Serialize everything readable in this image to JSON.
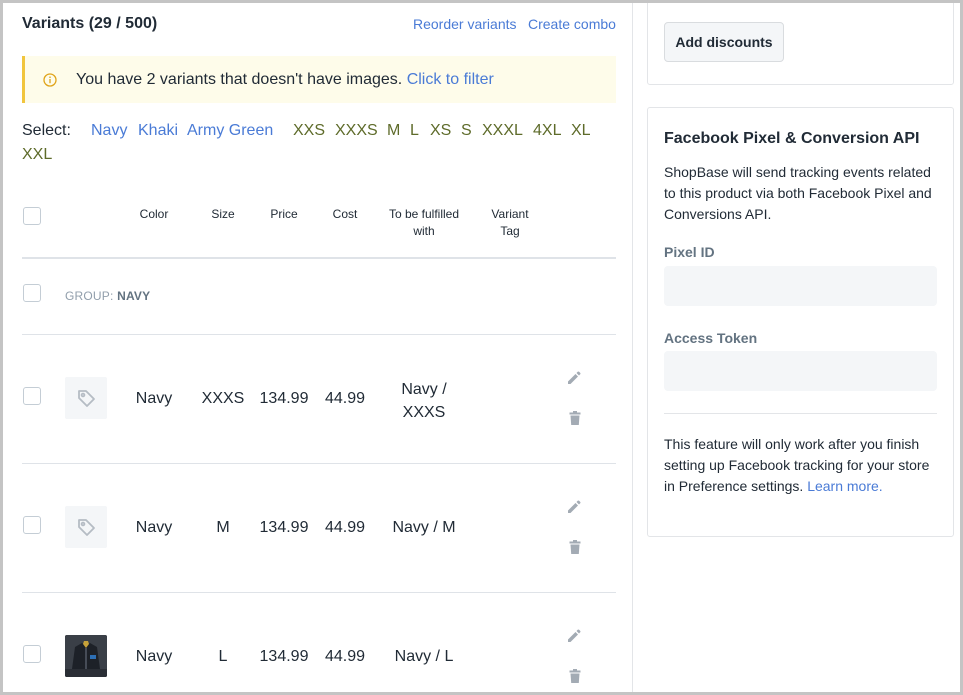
{
  "variants": {
    "title": "Variants (29 / 500)",
    "reorder_label": "Reorder variants",
    "combo_label": "Create combo",
    "banner": {
      "message": "You have 2 variants that doesn't have images.",
      "link": "Click to filter"
    },
    "select": {
      "label": "Select:",
      "colors": [
        "Navy",
        "Khaki",
        "Army Green"
      ],
      "sizes": [
        "XXS",
        "XXXS",
        "M",
        "L",
        "XS",
        "S",
        "XXXL",
        "4XL",
        "XL",
        "XXL"
      ]
    },
    "columns": {
      "color": "Color",
      "size": "Size",
      "price": "Price",
      "cost": "Cost",
      "fulfilled_line1": "To be fulfilled",
      "fulfilled_line2": "with",
      "tag_line1": "Variant",
      "tag_line2": "Tag"
    },
    "group": {
      "prefix": "GROUP:",
      "name": "NAVY"
    },
    "rows": [
      {
        "color": "Navy",
        "size": "XXXS",
        "price": "134.99",
        "cost": "44.99",
        "fulfilled_line1": "Navy /",
        "fulfilled_line2": "XXXS",
        "image": "placeholder"
      },
      {
        "color": "Navy",
        "size": "M",
        "price": "134.99",
        "cost": "44.99",
        "fulfilled_line1": "Navy / M",
        "image": "placeholder"
      },
      {
        "color": "Navy",
        "size": "L",
        "price": "134.99",
        "cost": "44.99",
        "fulfilled_line1": "Navy / L",
        "image": "photo"
      }
    ]
  },
  "discounts": {
    "button_label": "Add discounts"
  },
  "facebook": {
    "title": "Facebook Pixel & Conversion API",
    "description": "ShopBase will send tracking events related to this product via both Facebook Pixel and Conversions API.",
    "pixel_label": "Pixel ID",
    "pixel_value": "",
    "pixel_placeholder": "",
    "token_label": "Access Token",
    "token_value": "",
    "token_placeholder": "",
    "note": "This feature will only work after you finish setting up Facebook tracking for your store in Preference settings.",
    "note_link": "Learn more."
  },
  "colors": {
    "link": "#4a7bd6",
    "size_chip": "#5e6b2a",
    "banner_bg": "#fefcea",
    "banner_accent": "#f1c53d",
    "muted": "#919eab"
  },
  "icons": {
    "banner": "info-icon",
    "placeholder": "tag-icon",
    "edit": "pencil-icon",
    "delete": "trash-icon"
  }
}
